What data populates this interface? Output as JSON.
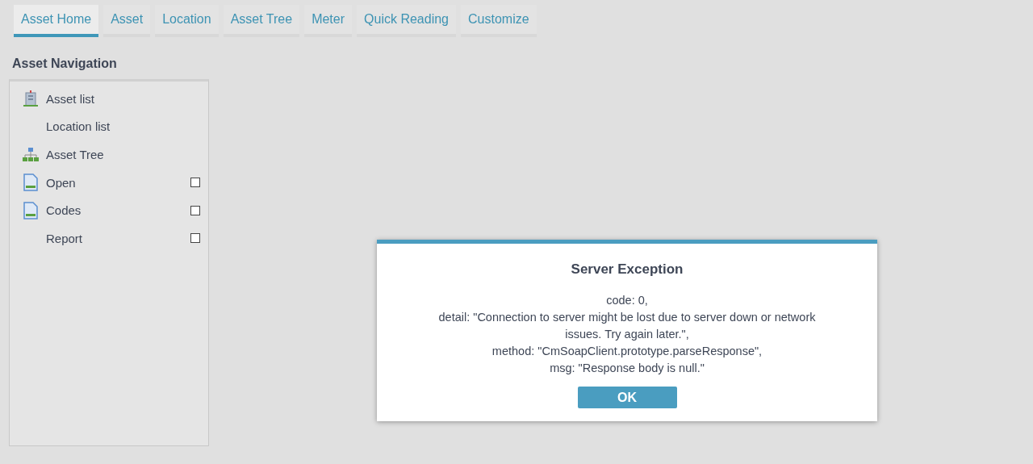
{
  "tabs": [
    {
      "label": "Asset Home",
      "selected": true
    },
    {
      "label": "Asset",
      "selected": false
    },
    {
      "label": "Location",
      "selected": false
    },
    {
      "label": "Asset Tree",
      "selected": false
    },
    {
      "label": "Meter",
      "selected": false
    },
    {
      "label": "Quick Reading",
      "selected": false
    },
    {
      "label": "Customize",
      "selected": false
    }
  ],
  "sidebar": {
    "title": "Asset Navigation",
    "items": [
      {
        "label": "Asset list",
        "kind": "building"
      },
      {
        "label": "Location list",
        "kind": "plain"
      },
      {
        "label": "Asset Tree",
        "kind": "tree"
      },
      {
        "label": "Open",
        "kind": "document",
        "checked": false
      },
      {
        "label": "Codes",
        "kind": "document",
        "checked": false
      },
      {
        "label": "Report",
        "kind": "plain",
        "checked": false
      }
    ]
  },
  "dialog": {
    "title": "Server Exception",
    "lines": [
      "code: 0,",
      "detail: \"Connection to server might be lost due to server down or network issues. Try again later.\",",
      "method: \"CmSoapClient.prototype.parseResponse\",",
      "msg: \"Response body is null.\""
    ],
    "button": "OK"
  }
}
